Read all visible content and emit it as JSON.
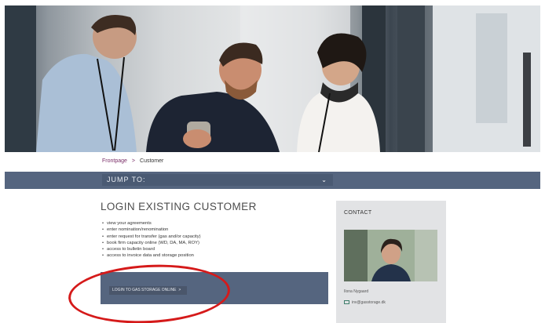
{
  "breadcrumb": {
    "home": "Frontpage",
    "separator": ">",
    "current": "Customer"
  },
  "jump": {
    "label": "JUMP TO:",
    "icon": "chevron-down-icon"
  },
  "main": {
    "title": "LOGIN EXISTING CUSTOMER",
    "items": [
      "view your agreements",
      "enter nomination/renomination",
      "enter request for transfer (gas and/or capacity)",
      "book firm capacity online (WD, DA, MA, ROY)",
      "access to bulletin board",
      "access to invoice data and storage position"
    ],
    "login_button": "LOGIN TO GAS STORAGE ONLINE",
    "login_arrow": ">"
  },
  "contact": {
    "heading": "CONTACT",
    "name": "Ilona Nygaard",
    "email": "inv@gasstorage.dk"
  },
  "colors": {
    "bar": "#55657f",
    "annotation": "#d51a1a",
    "link": "#7a2e68"
  }
}
